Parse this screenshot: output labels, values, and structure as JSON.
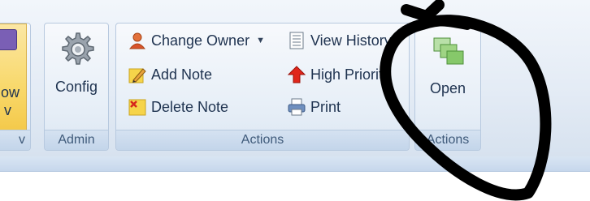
{
  "ribbon": {
    "cut_off_group": {
      "button_text_line1": "ow",
      "button_text_line2": "v",
      "label": "v"
    },
    "admin_group": {
      "label": "Admin",
      "config_button": {
        "label": "Config",
        "icon": "gear-icon"
      }
    },
    "actions_group": {
      "label": "Actions",
      "buttons": [
        {
          "label": "Change Owner",
          "icon": "user-icon",
          "has_dropdown": true
        },
        {
          "label": "Add Note",
          "icon": "pencil-icon"
        },
        {
          "label": "Delete Note",
          "icon": "delete-note-icon"
        },
        {
          "label": "View History",
          "icon": "document-list-icon"
        },
        {
          "label": "High Priority",
          "icon": "red-arrow-up-icon"
        },
        {
          "label": "Print",
          "icon": "printer-icon"
        }
      ]
    },
    "open_group": {
      "label": "Actions",
      "open_button": {
        "label": "Open",
        "icon": "open-stack-icon"
      }
    }
  },
  "colors": {
    "accent_yellow": "#f8d86a",
    "ink": "#000000",
    "text": "#1f3350",
    "group_label_text": "#3f5a7a"
  }
}
